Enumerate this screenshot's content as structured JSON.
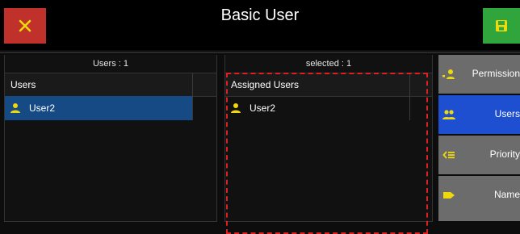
{
  "header": {
    "title": "Basic User",
    "close_icon": "close-icon",
    "save_icon": "save-icon",
    "colors": {
      "close": "#c0312b",
      "save": "#2fa53c",
      "accent": "#f0d90a"
    }
  },
  "users_panel": {
    "caption": "Users : 1",
    "column_header": "Users",
    "rows": [
      {
        "label": "User2",
        "selected": true
      }
    ]
  },
  "assigned_panel": {
    "caption": "selected : 1",
    "column_header": "Assigned Users",
    "rows": [
      {
        "label": "User2",
        "selected": false
      }
    ]
  },
  "sidebar": {
    "items": [
      {
        "label": "Permission",
        "icon": "user-permission-icon",
        "active": false
      },
      {
        "label": "Users",
        "icon": "users-group-icon",
        "active": true
      },
      {
        "label": "Priority",
        "icon": "priority-icon",
        "active": false
      },
      {
        "label": "Name",
        "icon": "name-tag-icon",
        "active": false
      }
    ]
  }
}
